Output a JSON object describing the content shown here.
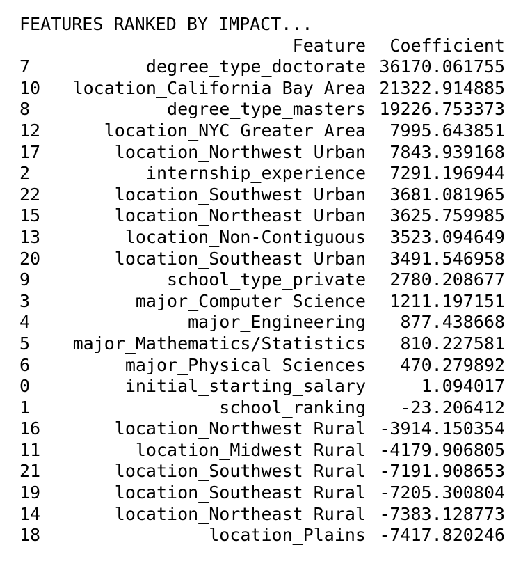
{
  "output": {
    "heading": "FEATURES RANKED BY IMPACT...",
    "columns": {
      "feature": "Feature",
      "coefficient": "Coefficient"
    },
    "rows": [
      {
        "index": "7",
        "feature": "degree_type_doctorate",
        "coefficient": "36170.061755"
      },
      {
        "index": "10",
        "feature": "location_California Bay Area",
        "coefficient": "21322.914885"
      },
      {
        "index": "8",
        "feature": "degree_type_masters",
        "coefficient": "19226.753373"
      },
      {
        "index": "12",
        "feature": "location_NYC Greater Area",
        "coefficient": "7995.643851"
      },
      {
        "index": "17",
        "feature": "location_Northwest Urban",
        "coefficient": "7843.939168"
      },
      {
        "index": "2",
        "feature": "internship_experience",
        "coefficient": "7291.196944"
      },
      {
        "index": "22",
        "feature": "location_Southwest Urban",
        "coefficient": "3681.081965"
      },
      {
        "index": "15",
        "feature": "location_Northeast Urban",
        "coefficient": "3625.759985"
      },
      {
        "index": "13",
        "feature": "location_Non-Contiguous",
        "coefficient": "3523.094649"
      },
      {
        "index": "20",
        "feature": "location_Southeast Urban",
        "coefficient": "3491.546958"
      },
      {
        "index": "9",
        "feature": "school_type_private",
        "coefficient": "2780.208677"
      },
      {
        "index": "3",
        "feature": "major_Computer Science",
        "coefficient": "1211.197151"
      },
      {
        "index": "4",
        "feature": "major_Engineering",
        "coefficient": "877.438668"
      },
      {
        "index": "5",
        "feature": "major_Mathematics/Statistics",
        "coefficient": "810.227581"
      },
      {
        "index": "6",
        "feature": "major_Physical Sciences",
        "coefficient": "470.279892"
      },
      {
        "index": "0",
        "feature": "initial_starting_salary",
        "coefficient": "1.094017"
      },
      {
        "index": "1",
        "feature": "school_ranking",
        "coefficient": "-23.206412"
      },
      {
        "index": "16",
        "feature": "location_Northwest Rural",
        "coefficient": "-3914.150354"
      },
      {
        "index": "11",
        "feature": "location_Midwest Rural",
        "coefficient": "-4179.906805"
      },
      {
        "index": "21",
        "feature": "location_Southwest Rural",
        "coefficient": "-7191.908653"
      },
      {
        "index": "19",
        "feature": "location_Southeast Rural",
        "coefficient": "-7205.300804"
      },
      {
        "index": "14",
        "feature": "location_Northeast Rural",
        "coefficient": "-7383.128773"
      },
      {
        "index": "18",
        "feature": "location_Plains",
        "coefficient": "-7417.820246"
      }
    ]
  }
}
